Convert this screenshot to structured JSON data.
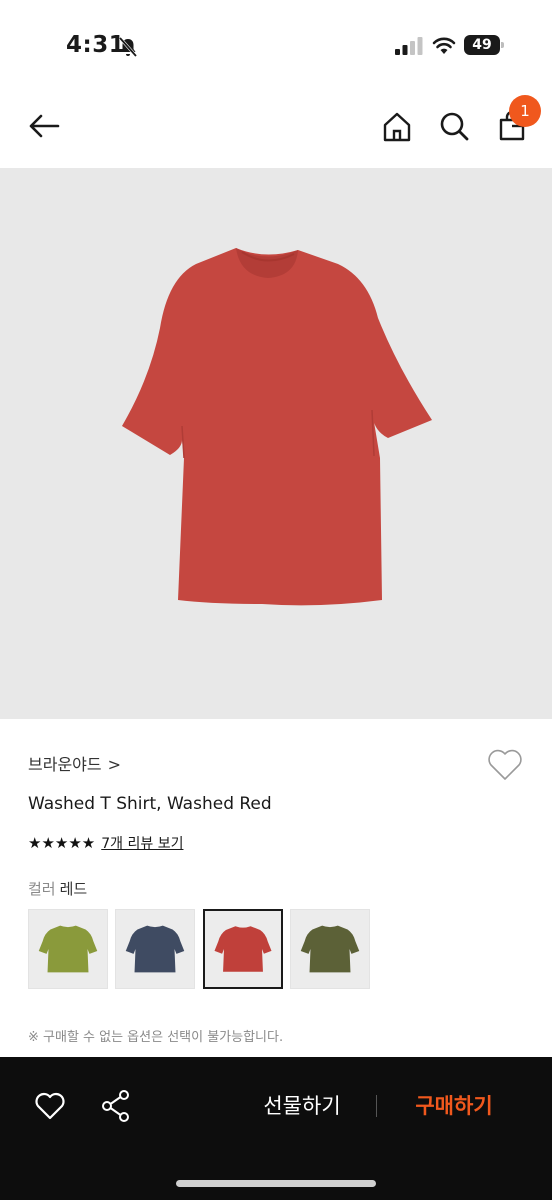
{
  "status_bar": {
    "time": "4:31",
    "battery": "49"
  },
  "header": {
    "cart_count": "1",
    "icons": [
      "back-arrow-icon",
      "home-icon",
      "search-icon",
      "bag-icon"
    ]
  },
  "product": {
    "brand": "브라운야드",
    "brand_chevron": ">",
    "name": "Washed T Shirt, Washed Red",
    "stars": "★★★★★",
    "rating": 5,
    "review_link": "7개 리뷰 보기",
    "color_key": "컬러",
    "color_value": "레드",
    "swatches": [
      {
        "color": "#8a9a3b",
        "selected": false
      },
      {
        "color": "#3f4b62",
        "selected": false
      },
      {
        "color": "#c0403a",
        "selected": true
      },
      {
        "color": "#5c6137",
        "selected": false
      }
    ],
    "notice": "※ 구매할 수 없는 옵션은 선택이 불가능합니다."
  },
  "bottom_bar": {
    "gift_label": "선물하기",
    "buy_label": "구매하기"
  },
  "colors": {
    "accent": "#f0581d",
    "bar_bg": "#0d0d0d",
    "image_bg": "#e8e8e8",
    "shirt": "#c54740"
  }
}
